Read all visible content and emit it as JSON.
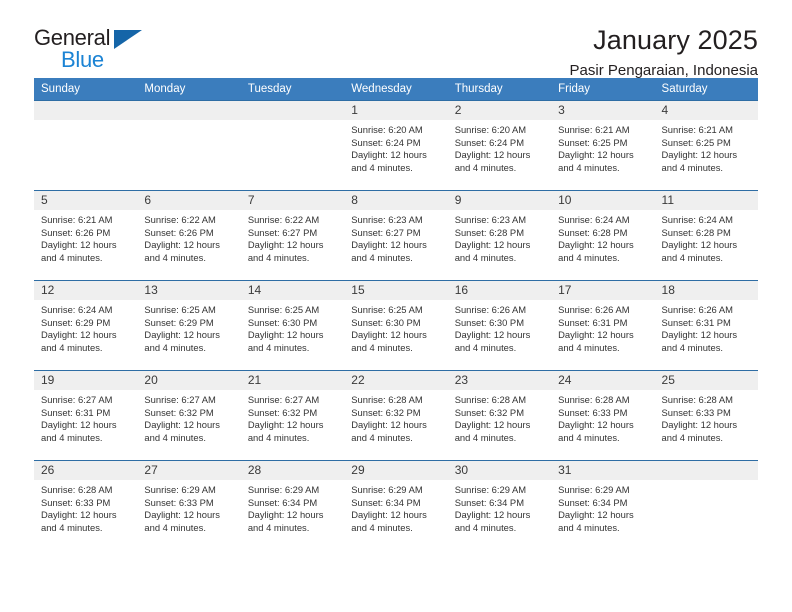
{
  "brand": {
    "name_dark": "General",
    "name_light": "Blue",
    "triangle_color": "#1565a8",
    "light_color": "#1b83d4"
  },
  "header": {
    "month_title": "January 2025",
    "location": "Pasir Pengaraian, Indonesia"
  },
  "theme": {
    "header_bg": "#3b7dbd",
    "cell_border": "#2e6da4",
    "daynum_bg": "#efefef"
  },
  "weekdays": [
    "Sunday",
    "Monday",
    "Tuesday",
    "Wednesday",
    "Thursday",
    "Friday",
    "Saturday"
  ],
  "weeks": [
    [
      {
        "day": "",
        "empty": true
      },
      {
        "day": "",
        "empty": true
      },
      {
        "day": "",
        "empty": true
      },
      {
        "day": "1",
        "sunrise": "Sunrise: 6:20 AM",
        "sunset": "Sunset: 6:24 PM",
        "daylight": "Daylight: 12 hours and 4 minutes."
      },
      {
        "day": "2",
        "sunrise": "Sunrise: 6:20 AM",
        "sunset": "Sunset: 6:24 PM",
        "daylight": "Daylight: 12 hours and 4 minutes."
      },
      {
        "day": "3",
        "sunrise": "Sunrise: 6:21 AM",
        "sunset": "Sunset: 6:25 PM",
        "daylight": "Daylight: 12 hours and 4 minutes."
      },
      {
        "day": "4",
        "sunrise": "Sunrise: 6:21 AM",
        "sunset": "Sunset: 6:25 PM",
        "daylight": "Daylight: 12 hours and 4 minutes."
      }
    ],
    [
      {
        "day": "5",
        "sunrise": "Sunrise: 6:21 AM",
        "sunset": "Sunset: 6:26 PM",
        "daylight": "Daylight: 12 hours and 4 minutes."
      },
      {
        "day": "6",
        "sunrise": "Sunrise: 6:22 AM",
        "sunset": "Sunset: 6:26 PM",
        "daylight": "Daylight: 12 hours and 4 minutes."
      },
      {
        "day": "7",
        "sunrise": "Sunrise: 6:22 AM",
        "sunset": "Sunset: 6:27 PM",
        "daylight": "Daylight: 12 hours and 4 minutes."
      },
      {
        "day": "8",
        "sunrise": "Sunrise: 6:23 AM",
        "sunset": "Sunset: 6:27 PM",
        "daylight": "Daylight: 12 hours and 4 minutes."
      },
      {
        "day": "9",
        "sunrise": "Sunrise: 6:23 AM",
        "sunset": "Sunset: 6:28 PM",
        "daylight": "Daylight: 12 hours and 4 minutes."
      },
      {
        "day": "10",
        "sunrise": "Sunrise: 6:24 AM",
        "sunset": "Sunset: 6:28 PM",
        "daylight": "Daylight: 12 hours and 4 minutes."
      },
      {
        "day": "11",
        "sunrise": "Sunrise: 6:24 AM",
        "sunset": "Sunset: 6:28 PM",
        "daylight": "Daylight: 12 hours and 4 minutes."
      }
    ],
    [
      {
        "day": "12",
        "sunrise": "Sunrise: 6:24 AM",
        "sunset": "Sunset: 6:29 PM",
        "daylight": "Daylight: 12 hours and 4 minutes."
      },
      {
        "day": "13",
        "sunrise": "Sunrise: 6:25 AM",
        "sunset": "Sunset: 6:29 PM",
        "daylight": "Daylight: 12 hours and 4 minutes."
      },
      {
        "day": "14",
        "sunrise": "Sunrise: 6:25 AM",
        "sunset": "Sunset: 6:30 PM",
        "daylight": "Daylight: 12 hours and 4 minutes."
      },
      {
        "day": "15",
        "sunrise": "Sunrise: 6:25 AM",
        "sunset": "Sunset: 6:30 PM",
        "daylight": "Daylight: 12 hours and 4 minutes."
      },
      {
        "day": "16",
        "sunrise": "Sunrise: 6:26 AM",
        "sunset": "Sunset: 6:30 PM",
        "daylight": "Daylight: 12 hours and 4 minutes."
      },
      {
        "day": "17",
        "sunrise": "Sunrise: 6:26 AM",
        "sunset": "Sunset: 6:31 PM",
        "daylight": "Daylight: 12 hours and 4 minutes."
      },
      {
        "day": "18",
        "sunrise": "Sunrise: 6:26 AM",
        "sunset": "Sunset: 6:31 PM",
        "daylight": "Daylight: 12 hours and 4 minutes."
      }
    ],
    [
      {
        "day": "19",
        "sunrise": "Sunrise: 6:27 AM",
        "sunset": "Sunset: 6:31 PM",
        "daylight": "Daylight: 12 hours and 4 minutes."
      },
      {
        "day": "20",
        "sunrise": "Sunrise: 6:27 AM",
        "sunset": "Sunset: 6:32 PM",
        "daylight": "Daylight: 12 hours and 4 minutes."
      },
      {
        "day": "21",
        "sunrise": "Sunrise: 6:27 AM",
        "sunset": "Sunset: 6:32 PM",
        "daylight": "Daylight: 12 hours and 4 minutes."
      },
      {
        "day": "22",
        "sunrise": "Sunrise: 6:28 AM",
        "sunset": "Sunset: 6:32 PM",
        "daylight": "Daylight: 12 hours and 4 minutes."
      },
      {
        "day": "23",
        "sunrise": "Sunrise: 6:28 AM",
        "sunset": "Sunset: 6:32 PM",
        "daylight": "Daylight: 12 hours and 4 minutes."
      },
      {
        "day": "24",
        "sunrise": "Sunrise: 6:28 AM",
        "sunset": "Sunset: 6:33 PM",
        "daylight": "Daylight: 12 hours and 4 minutes."
      },
      {
        "day": "25",
        "sunrise": "Sunrise: 6:28 AM",
        "sunset": "Sunset: 6:33 PM",
        "daylight": "Daylight: 12 hours and 4 minutes."
      }
    ],
    [
      {
        "day": "26",
        "sunrise": "Sunrise: 6:28 AM",
        "sunset": "Sunset: 6:33 PM",
        "daylight": "Daylight: 12 hours and 4 minutes."
      },
      {
        "day": "27",
        "sunrise": "Sunrise: 6:29 AM",
        "sunset": "Sunset: 6:33 PM",
        "daylight": "Daylight: 12 hours and 4 minutes."
      },
      {
        "day": "28",
        "sunrise": "Sunrise: 6:29 AM",
        "sunset": "Sunset: 6:34 PM",
        "daylight": "Daylight: 12 hours and 4 minutes."
      },
      {
        "day": "29",
        "sunrise": "Sunrise: 6:29 AM",
        "sunset": "Sunset: 6:34 PM",
        "daylight": "Daylight: 12 hours and 4 minutes."
      },
      {
        "day": "30",
        "sunrise": "Sunrise: 6:29 AM",
        "sunset": "Sunset: 6:34 PM",
        "daylight": "Daylight: 12 hours and 4 minutes."
      },
      {
        "day": "31",
        "sunrise": "Sunrise: 6:29 AM",
        "sunset": "Sunset: 6:34 PM",
        "daylight": "Daylight: 12 hours and 4 minutes."
      },
      {
        "day": "",
        "empty": true
      }
    ]
  ]
}
